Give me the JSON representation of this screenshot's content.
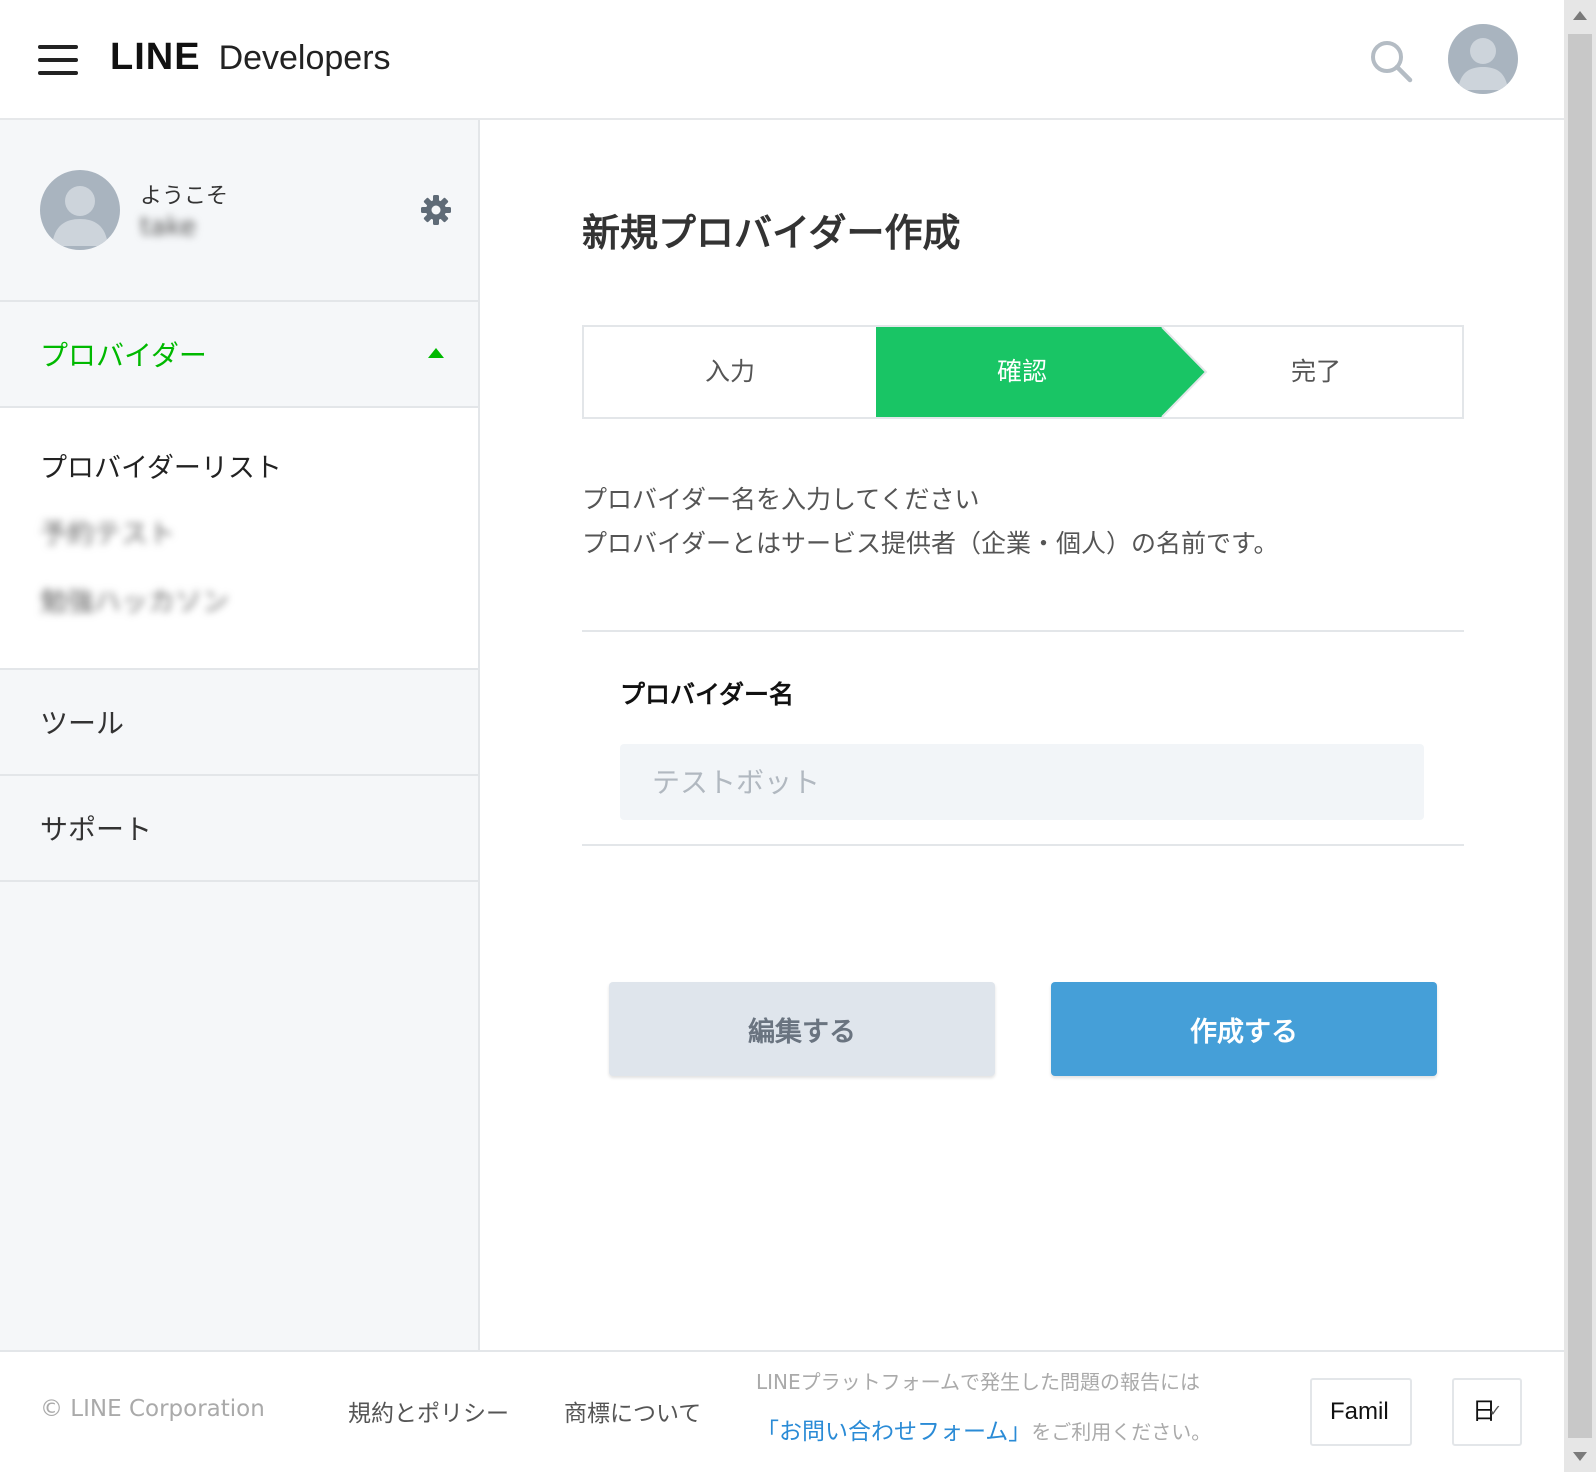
{
  "header": {
    "logo_line": "LINE",
    "logo_developers": "Developers",
    "icons": [
      "hamburger-menu-icon",
      "search-icon",
      "user-avatar"
    ]
  },
  "sidebar": {
    "welcome": "ようこそ",
    "username": "take",
    "provider_section": {
      "label": "プロバイダー",
      "expanded": true
    },
    "sub_items": [
      {
        "label": "プロバイダーリスト"
      },
      {
        "label": "予約テスト"
      },
      {
        "label": "勉強ハッカソン"
      }
    ],
    "items": [
      {
        "label": "ツール"
      },
      {
        "label": "サポート"
      }
    ]
  },
  "main": {
    "title": "新規プロバイダー作成",
    "steps": [
      {
        "label": "入力",
        "active": false
      },
      {
        "label": "確認",
        "active": true
      },
      {
        "label": "完了",
        "active": false
      }
    ],
    "description_line1": "プロバイダー名を入力してください",
    "description_line2": "プロバイダーとはサービス提供者（企業・個人）の名前です。",
    "field": {
      "label": "プロバイダー名",
      "placeholder": "テストボット",
      "value": ""
    },
    "buttons": {
      "edit": "編集する",
      "create": "作成する"
    }
  },
  "footer": {
    "copyright": "© LINE Corporation",
    "links": [
      "規約とポリシー",
      "商標について"
    ],
    "report_text": "LINEプラットフォームで発生した問題の報告には",
    "report_link": "「お問い合わせフォーム」",
    "report_suffix": "をご利用ください。",
    "family_select": "Famil",
    "language_select": "日"
  },
  "colors": {
    "brand_green": "#00b900",
    "step_active": "#19c565",
    "primary_button": "#459fd8",
    "secondary_button": "#dfe5ec",
    "sidebar_bg": "#f5f7f9",
    "link_blue": "#2a8bd6"
  }
}
